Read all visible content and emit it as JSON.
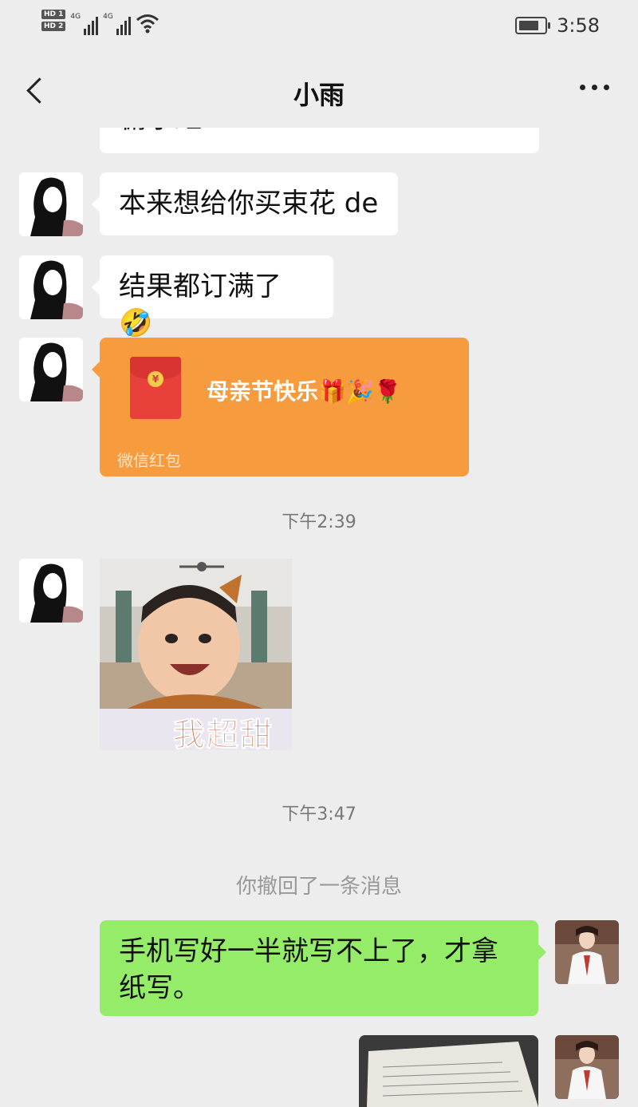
{
  "status_bar": {
    "hd1": "HD 1",
    "hd2": "HD 2",
    "net1": "4G",
    "net2": "4G",
    "time": "3:58"
  },
  "header": {
    "title": "小雨"
  },
  "messages": {
    "partial_text": "俯示虹",
    "msg1": "本来想给你买束花 de",
    "msg2": "结果都订满了",
    "red_packet_title": "母亲节快乐",
    "red_packet_label": "微信红包",
    "red_packet_coin": "¥",
    "time1": "下午2:39",
    "sticker_caption": "我超甜",
    "time2": "下午3:47",
    "recalled": "你撤回了一条消息",
    "my_msg": "手机写好一半就写不上了，才拿纸写。"
  },
  "icons": {
    "emoji_cry_laugh": "🤣",
    "emoji_gift": "🎁",
    "emoji_party": "🎉",
    "emoji_rose": "🌹"
  }
}
